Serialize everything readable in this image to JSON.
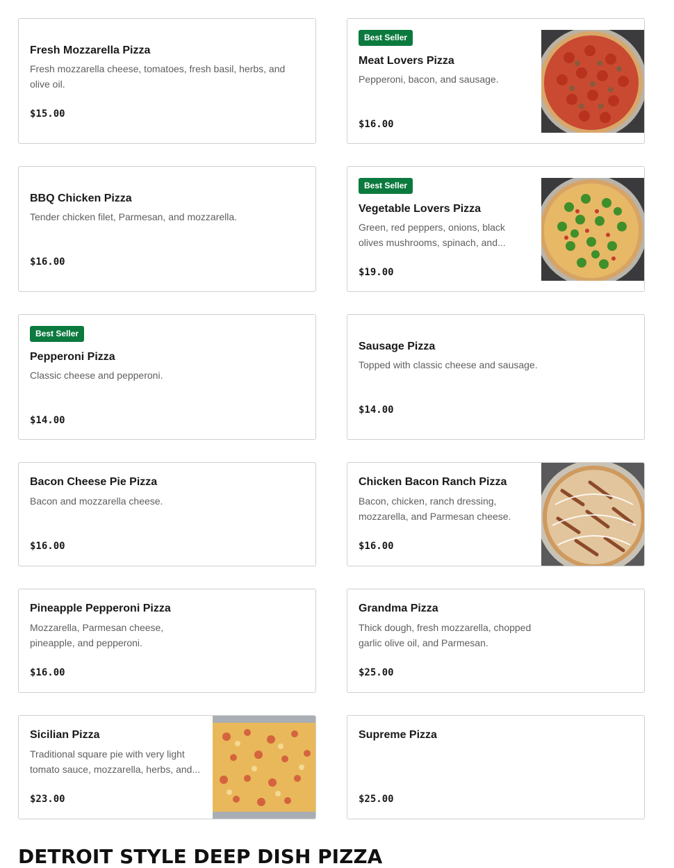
{
  "menu": {
    "badge_label": "Best Seller",
    "items": [
      {
        "name": "Fresh Mozzarella Pizza",
        "description": "Fresh mozzarella cheese, tomatoes, fresh basil, herbs, and olive oil.",
        "price": "$15.00"
      },
      {
        "name": "Meat Lovers Pizza",
        "description": "Pepperoni, bacon, and sausage.",
        "price": "$16.00",
        "badge": "Best Seller",
        "image": "pepperoni-sausage-pizza"
      },
      {
        "name": "BBQ Chicken Pizza",
        "description": "Tender chicken filet, Parmesan, and mozzarella.",
        "price": "$16.00"
      },
      {
        "name": "Vegetable Lovers Pizza",
        "description": "Green, red peppers, onions, black olives mushrooms, spinach, and...",
        "price": "$19.00",
        "badge": "Best Seller",
        "image": "vegetable-pizza"
      },
      {
        "name": "Pepperoni Pizza",
        "description": "Classic cheese and pepperoni.",
        "price": "$14.00",
        "badge": "Best Seller"
      },
      {
        "name": "Sausage Pizza",
        "description": "Topped with classic cheese and sausage.",
        "price": "$14.00"
      },
      {
        "name": "Bacon Cheese Pie Pizza",
        "description": "Bacon and mozzarella cheese.",
        "price": "$16.00"
      },
      {
        "name": "Chicken Bacon Ranch Pizza",
        "description": "Bacon, chicken, ranch dressing, mozzarella, and Parmesan cheese.",
        "price": "$16.00",
        "image": "chicken-bacon-ranch-pizza"
      },
      {
        "name": "Pineapple Pepperoni Pizza",
        "description": "Mozzarella, Parmesan cheese, pineapple, and pepperoni.",
        "price": "$16.00"
      },
      {
        "name": "Grandma Pizza",
        "description": "Thick dough, fresh mozzarella, chopped garlic olive oil, and Parmesan.",
        "price": "$25.00"
      },
      {
        "name": "Sicilian Pizza",
        "description": "Traditional square pie with very light tomato sauce, mozzarella, herbs, and...",
        "price": "$23.00",
        "image": "sicilian-pizza"
      },
      {
        "name": "Supreme Pizza",
        "description": "",
        "price": "$25.00"
      }
    ]
  },
  "next_section": {
    "title": "DETROIT STYLE DEEP DISH PIZZA"
  },
  "colors": {
    "badge": "#0c7a3e",
    "border": "#cfcfcf",
    "text": "#191919",
    "muted": "#5e5e5e"
  }
}
